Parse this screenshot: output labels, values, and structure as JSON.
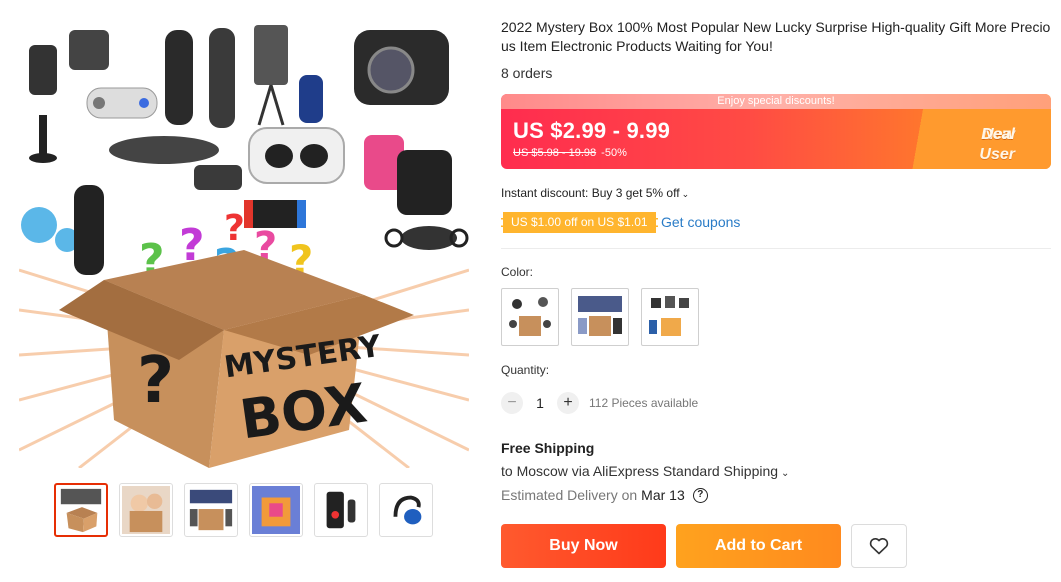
{
  "product": {
    "title": "2022 Mystery Box 100% Most Popular New Lucky Surprise High-quality Gift More Precious Item Electronic Products Waiting for You!",
    "orders": "8 orders",
    "image_text": {
      "word1": "MYSTERY",
      "word2": "BOX",
      "mark": "?"
    }
  },
  "price": {
    "strip": "Enjoy special discounts!",
    "current": "US $2.99 - 9.99",
    "original": "US $5.98 - 19.98",
    "discount": "-50%",
    "new_user_line1": "New User",
    "new_user_line2": "Deal"
  },
  "promo": {
    "instant_discount": "Instant discount: Buy 3 get 5% off",
    "coupon": "US $1.00 off on US $1.01",
    "get_coupons": "Get coupons"
  },
  "options": {
    "color_label": "Color:",
    "quantity_label": "Quantity:",
    "quantity_value": "1",
    "minus": "−",
    "plus": "+",
    "available": "112 Pieces available"
  },
  "shipping": {
    "title": "Free Shipping",
    "route": "to Moscow via AliExpress Standard Shipping",
    "delivery_label": "Estimated Delivery on",
    "delivery_date": "Mar 13",
    "help": "?"
  },
  "actions": {
    "buy_now": "Buy Now",
    "add_to_cart": "Add to Cart"
  },
  "colors": {
    "accent_red": "#e62e04",
    "buy_now": "#ff4a22",
    "add_cart": "#ff9a1e",
    "link": "#2a7cc7",
    "coupon": "#ffb52e"
  },
  "icons": {
    "heart": "heart-icon",
    "chevron": "chevron-down-icon",
    "help": "question-circle-icon"
  }
}
